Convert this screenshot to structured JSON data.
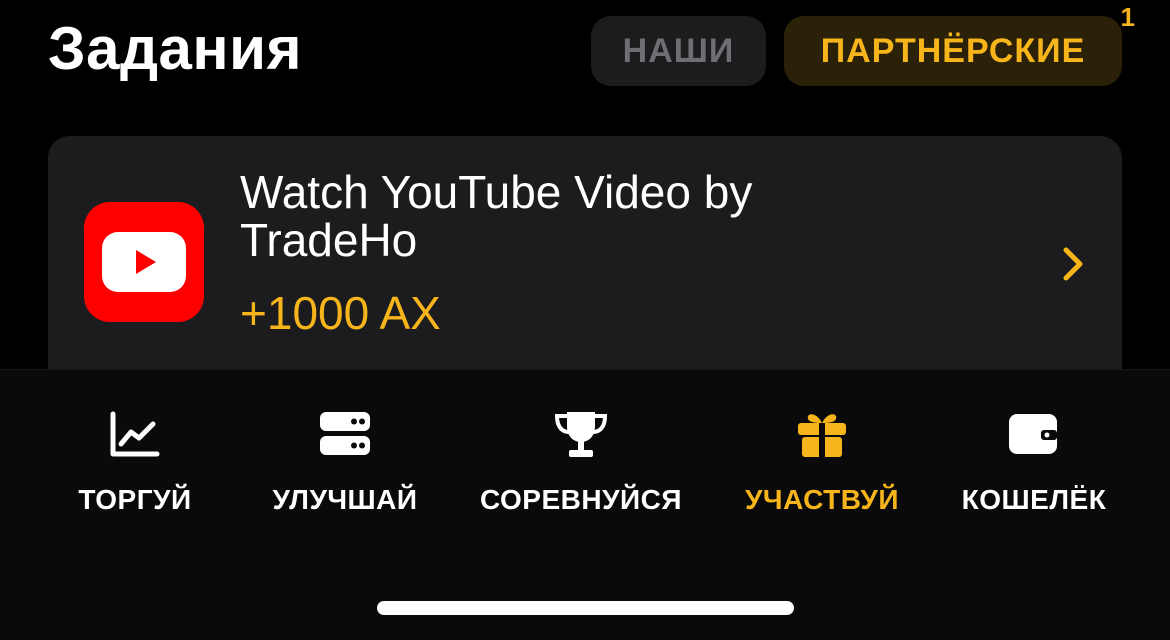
{
  "header": {
    "title": "Задания",
    "tabs": [
      {
        "label": "НАШИ",
        "active": false
      },
      {
        "label": "ПАРТНЁРСКИЕ",
        "active": true,
        "badge": "1"
      }
    ]
  },
  "task": {
    "icon": "youtube-icon",
    "title": "Watch YouTube Video by TradeHo",
    "reward": "+1000 AX"
  },
  "nav": {
    "items": [
      {
        "label": "ТОРГУЙ",
        "icon": "chart-icon",
        "active": false
      },
      {
        "label": "УЛУЧШАЙ",
        "icon": "server-icon",
        "active": false
      },
      {
        "label": "СОРЕВНУЙСЯ",
        "icon": "trophy-icon",
        "active": false
      },
      {
        "label": "УЧАСТВУЙ",
        "icon": "gift-icon",
        "active": true
      },
      {
        "label": "КОШЕЛЁК",
        "icon": "wallet-icon",
        "active": false
      }
    ]
  },
  "colors": {
    "accent": "#f7b51b",
    "background": "#000000",
    "card": "#1c1c1e",
    "youtube": "#ff0000"
  }
}
